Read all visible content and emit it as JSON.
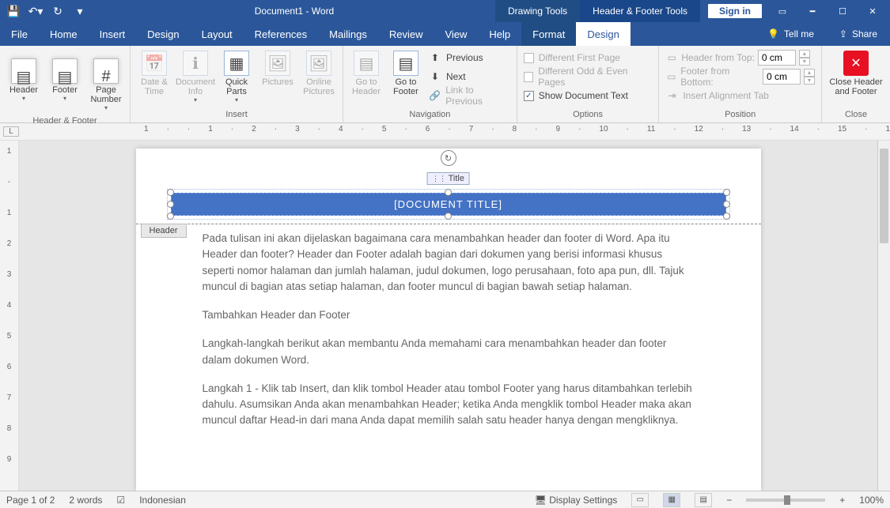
{
  "titlebar": {
    "doc_title": "Document1 - Word",
    "context1": "Drawing Tools",
    "context2": "Header & Footer Tools",
    "signin": "Sign in"
  },
  "menu": {
    "file": "File",
    "home": "Home",
    "insert": "Insert",
    "design": "Design",
    "layout": "Layout",
    "references": "References",
    "mailings": "Mailings",
    "review": "Review",
    "view": "View",
    "help": "Help",
    "format": "Format",
    "design2": "Design",
    "tellme": "Tell me",
    "share": "Share"
  },
  "ribbon": {
    "header_footer": {
      "label": "Header & Footer",
      "header": "Header",
      "footer": "Footer",
      "page_number": "Page Number"
    },
    "insert": {
      "label": "Insert",
      "date_time": "Date & Time",
      "doc_info": "Document Info",
      "quick_parts": "Quick Parts",
      "pictures": "Pictures",
      "online_pics": "Online Pictures"
    },
    "navigation": {
      "label": "Navigation",
      "goto_header": "Go to Header",
      "goto_footer": "Go to Footer",
      "previous": "Previous",
      "next": "Next",
      "link": "Link to Previous"
    },
    "options": {
      "label": "Options",
      "diff_first": "Different First Page",
      "diff_odd": "Different Odd & Even Pages",
      "show_doc": "Show Document Text"
    },
    "position": {
      "label": "Position",
      "from_top": "Header from Top:",
      "from_bottom": "Footer from Bottom:",
      "align_tab": "Insert Alignment Tab",
      "val_top": "0 cm",
      "val_bottom": "0 cm"
    },
    "close": {
      "label": "Close",
      "btn": "Close Header and Footer"
    }
  },
  "document": {
    "title_tag": "Title",
    "title_placeholder": "[DOCUMENT TITLE]",
    "header_tag": "Header",
    "para1": "Pada tulisan ini akan dijelaskan bagaimana cara menambahkan header dan footer di Word. Apa itu Header dan footer? Header dan Footer adalah bagian dari dokumen yang berisi informasi khusus seperti nomor halaman dan jumlah halaman, judul dokumen, logo perusahaan, foto apa pun, dll. Tajuk muncul di bagian atas setiap halaman, dan footer muncul di bagian bawah setiap halaman.",
    "para2": "Tambahkan Header dan Footer",
    "para3": "Langkah-langkah berikut akan membantu Anda memahami cara menambahkan header dan footer dalam dokumen Word.",
    "para4": "Langkah 1 - Klik tab Insert, dan klik tombol Header atau tombol Footer yang harus ditambahkan terlebih dahulu. Asumsikan Anda akan menambahkan Header; ketika Anda mengklik tombol Header maka akan muncul daftar Head-in dari mana Anda dapat memilih salah satu header hanya dengan mengkliknya."
  },
  "status": {
    "page": "Page 1 of 2",
    "words": "2 words",
    "lang": "Indonesian",
    "display": "Display Settings",
    "zoom": "100%"
  }
}
